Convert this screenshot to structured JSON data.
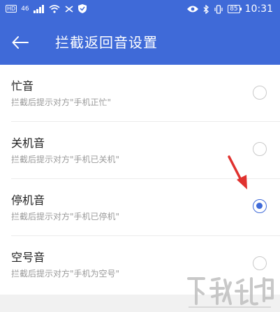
{
  "status_bar": {
    "left_badge": "HD",
    "signal_label": "46",
    "battery": "85",
    "time": "10:31"
  },
  "toolbar": {
    "title": "拦截返回音设置"
  },
  "options": [
    {
      "title": "忙音",
      "subtitle": "拦截后提示对方\"手机正忙\"",
      "selected": false
    },
    {
      "title": "关机音",
      "subtitle": "拦截后提示对方\"手机已关机\"",
      "selected": false
    },
    {
      "title": "停机音",
      "subtitle": "拦截后提示对方\"手机已停机\"",
      "selected": true
    },
    {
      "title": "空号音",
      "subtitle": "拦截后提示对方\"手机为空号\"",
      "selected": false
    }
  ],
  "colors": {
    "header": "#3f6ad8",
    "accent": "#3f6ad8",
    "annotation_arrow": "#e0322f"
  }
}
